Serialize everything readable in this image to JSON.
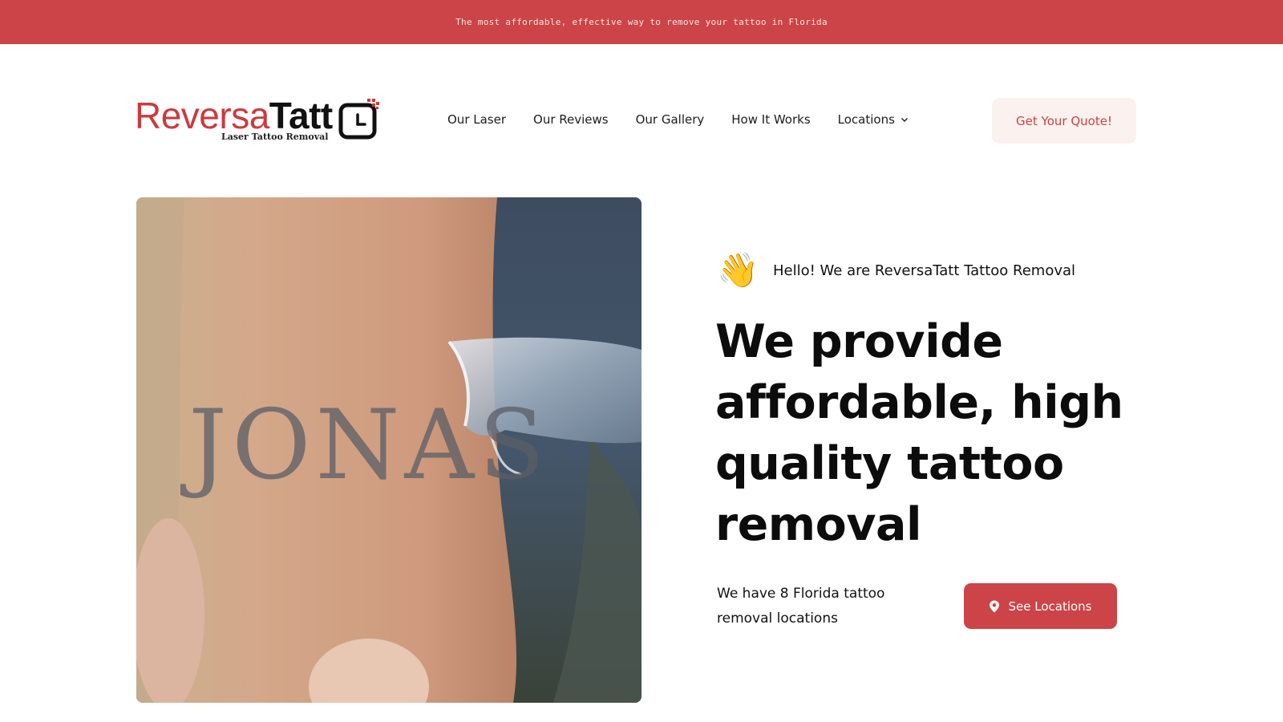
{
  "announcement": {
    "text": "The most affordable, effective way to remove your tattoo in Florida"
  },
  "brand": {
    "name_part1": "Reversa",
    "name_part2": "Tatt",
    "tagline": "Laser Tattoo Removal",
    "accent_color": "#cc4447"
  },
  "nav": {
    "items": [
      {
        "label": "Our Laser"
      },
      {
        "label": "Our Reviews"
      },
      {
        "label": "Our Gallery"
      },
      {
        "label": "How It Works"
      },
      {
        "label": "Locations",
        "has_dropdown": true
      }
    ],
    "cta_label": "Get Your Quote!"
  },
  "hero": {
    "greeting_emoji": "👋",
    "greeting_icon": "waving-hand-icon",
    "greeting": "Hello! We are ReversaTatt Tattoo Removal",
    "headline": "We provide affordable, high quality tattoo removal",
    "locations_text": "We have 8 Florida tattoo removal locations",
    "locations_button": "See Locations",
    "locations_button_icon": "map-pin-icon",
    "image_tattoo_text": "JONAS"
  }
}
